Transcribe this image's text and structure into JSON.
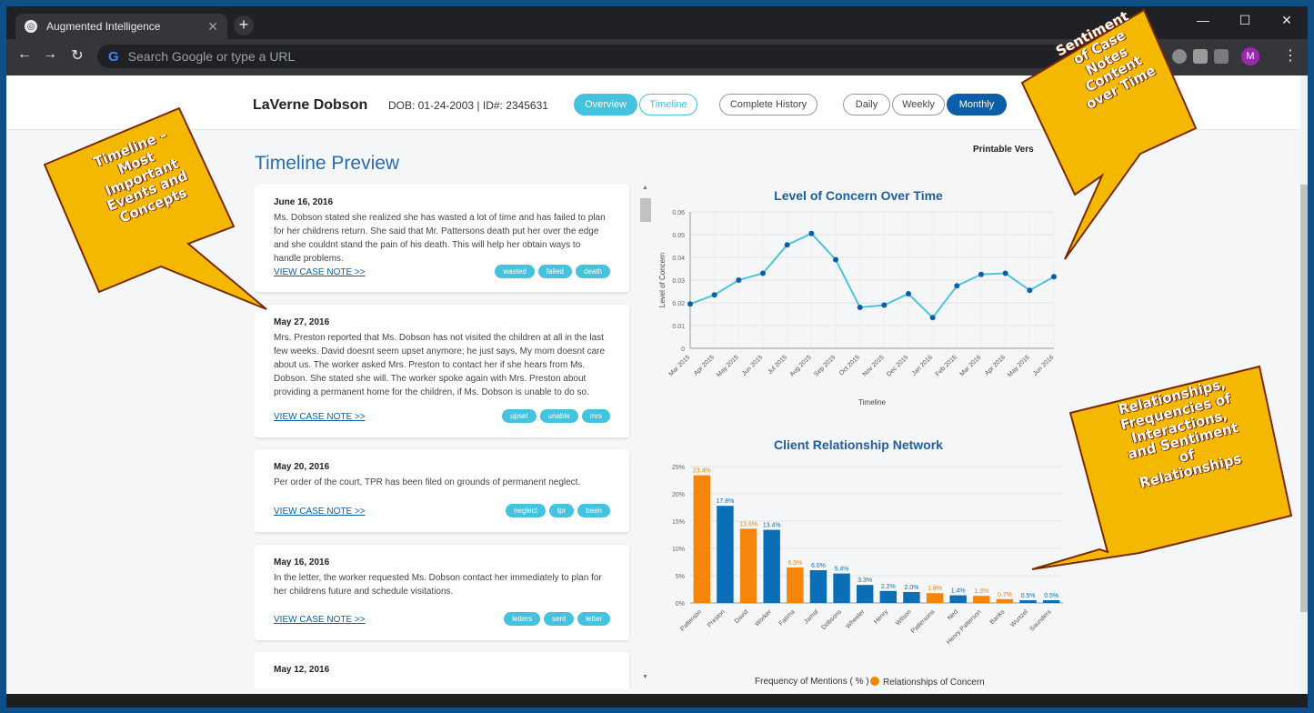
{
  "browser": {
    "tab_title": "Augmented Intelligence",
    "new_tab": "+",
    "omnibox_placeholder": "Search Google or type a URL",
    "profile_initial": "M",
    "window_controls": {
      "minimize": "—",
      "maximize": "☐",
      "close": "✕"
    }
  },
  "header": {
    "client_name": "LaVerne Dobson",
    "dob": "DOB: 01-24-2003",
    "id": "ID#: 2345631",
    "tabs": [
      "Overview",
      "Timeline"
    ],
    "history": "Complete History",
    "ranges": [
      "Daily",
      "Weekly",
      "Monthly"
    ],
    "printable": "Printable Vers"
  },
  "timeline": {
    "title": "Timeline Preview",
    "link_label": "VIEW CASE NOTE >>",
    "notes": [
      {
        "date": "June 16, 2016",
        "text": "Ms. Dobson stated she realized she has wasted a lot of time and has failed to plan for her childrens return. She said that Mr. Pattersons death put her over the edge and she couldnt stand the pain of his death. This will help her obtain ways to handle problems.",
        "tags": [
          "wasted",
          "failed",
          "death"
        ]
      },
      {
        "date": "May 27, 2016",
        "text": "Mrs. Preston reported that Ms. Dobson has not visited the children at all in the last few weeks. David doesnt seem upset anymore; he just says, My mom doesnt care about us. The worker asked Mrs. Preston to contact her if she hears from Ms. Dobson. She stated she will. The worker spoke again with Mrs. Preston about providing a permanent home for the children, if Ms. Dobson is unable to do so.",
        "tags": [
          "upset",
          "unable",
          "mrs"
        ]
      },
      {
        "date": "May 20, 2016",
        "text": "Per order of the court, TPR has been filed on grounds of permanent neglect.",
        "tags": [
          "neglect",
          "tpr",
          "been"
        ]
      },
      {
        "date": "May 16, 2016",
        "text": "In the letter, the worker requested Ms. Dobson contact her immediately to plan for her childrens future and schedule visitations.",
        "tags": [
          "letters",
          "sent",
          "letter"
        ]
      },
      {
        "date": "May 12, 2016",
        "text": "",
        "tags": []
      }
    ]
  },
  "chart_data": [
    {
      "type": "line",
      "title": "Level of Concern Over Time",
      "xlabel": "Timeline",
      "ylabel": "Level of Concern",
      "ylim": [
        0,
        0.06
      ],
      "yticks": [
        "0",
        "0.01",
        "0.02",
        "0.03",
        "0.04",
        "0.05",
        "0.06"
      ],
      "categories": [
        "Mar 2015",
        "Apr 2015",
        "May 2015",
        "Jun 2015",
        "Jul 2015",
        "Aug 2015",
        "Sep 2015",
        "Oct 2015",
        "Nov 2015",
        "Dec 2015",
        "Jan 2016",
        "Feb 2016",
        "Mar 2016",
        "Apr 2016",
        "May 2016",
        "Jun 2016"
      ],
      "values": [
        0.0195,
        0.0235,
        0.03,
        0.033,
        0.0455,
        0.0505,
        0.039,
        0.018,
        0.019,
        0.024,
        0.0135,
        0.0275,
        0.0325,
        0.033,
        0.0255,
        0.0315
      ],
      "color": "#4fc3de",
      "grid": true
    },
    {
      "type": "bar",
      "title": "Client Relationship Network",
      "ylim": [
        0,
        25
      ],
      "yticks": [
        "0%",
        "5%",
        "10%",
        "15%",
        "20%",
        "25%"
      ],
      "categories": [
        "Patterson",
        "Preston",
        "David",
        "Worker",
        "Fatima",
        "Jamal",
        "Dobsons",
        "Wheeler",
        "Henry",
        "Wilson",
        "Pattersons",
        "Ned",
        "Henry Patterson",
        "Banks",
        "Wurtzel",
        "Saunders"
      ],
      "values": [
        23.4,
        17.8,
        13.6,
        13.4,
        6.5,
        6.0,
        5.4,
        3.3,
        2.2,
        2.0,
        1.8,
        1.4,
        1.3,
        0.7,
        0.5,
        0.5
      ],
      "labels": [
        "23.4%",
        "17.8%",
        "13.6%",
        "13.4%",
        "6.5%",
        "6.0%",
        "5.4%",
        "3.3%",
        "2.2%",
        "2.0%",
        "1.8%",
        "1.4%",
        "1.3%",
        "0.7%",
        "0.5%",
        "0.5%"
      ],
      "concern": [
        true,
        false,
        true,
        false,
        true,
        false,
        false,
        false,
        false,
        false,
        true,
        false,
        true,
        true,
        false,
        false
      ],
      "colors": {
        "normal": "#0b6fb8",
        "concern": "#f7850b"
      },
      "legend": [
        "Frequency of Mentions ( % )",
        "Relationships of Concern"
      ],
      "grid": true
    }
  ],
  "callouts": {
    "timeline": "Timeline –\nMost\nImportant\nEvents and\nConcepts",
    "sentiment": "Sentiment\nof Case\nNotes\nContent\nover Time",
    "relationships": "Relationships,\nFrequencies of\nInteractions,\nand Sentiment\nof\nRelationships",
    "fill": "#f5b800",
    "stroke": "#7a2a00"
  }
}
